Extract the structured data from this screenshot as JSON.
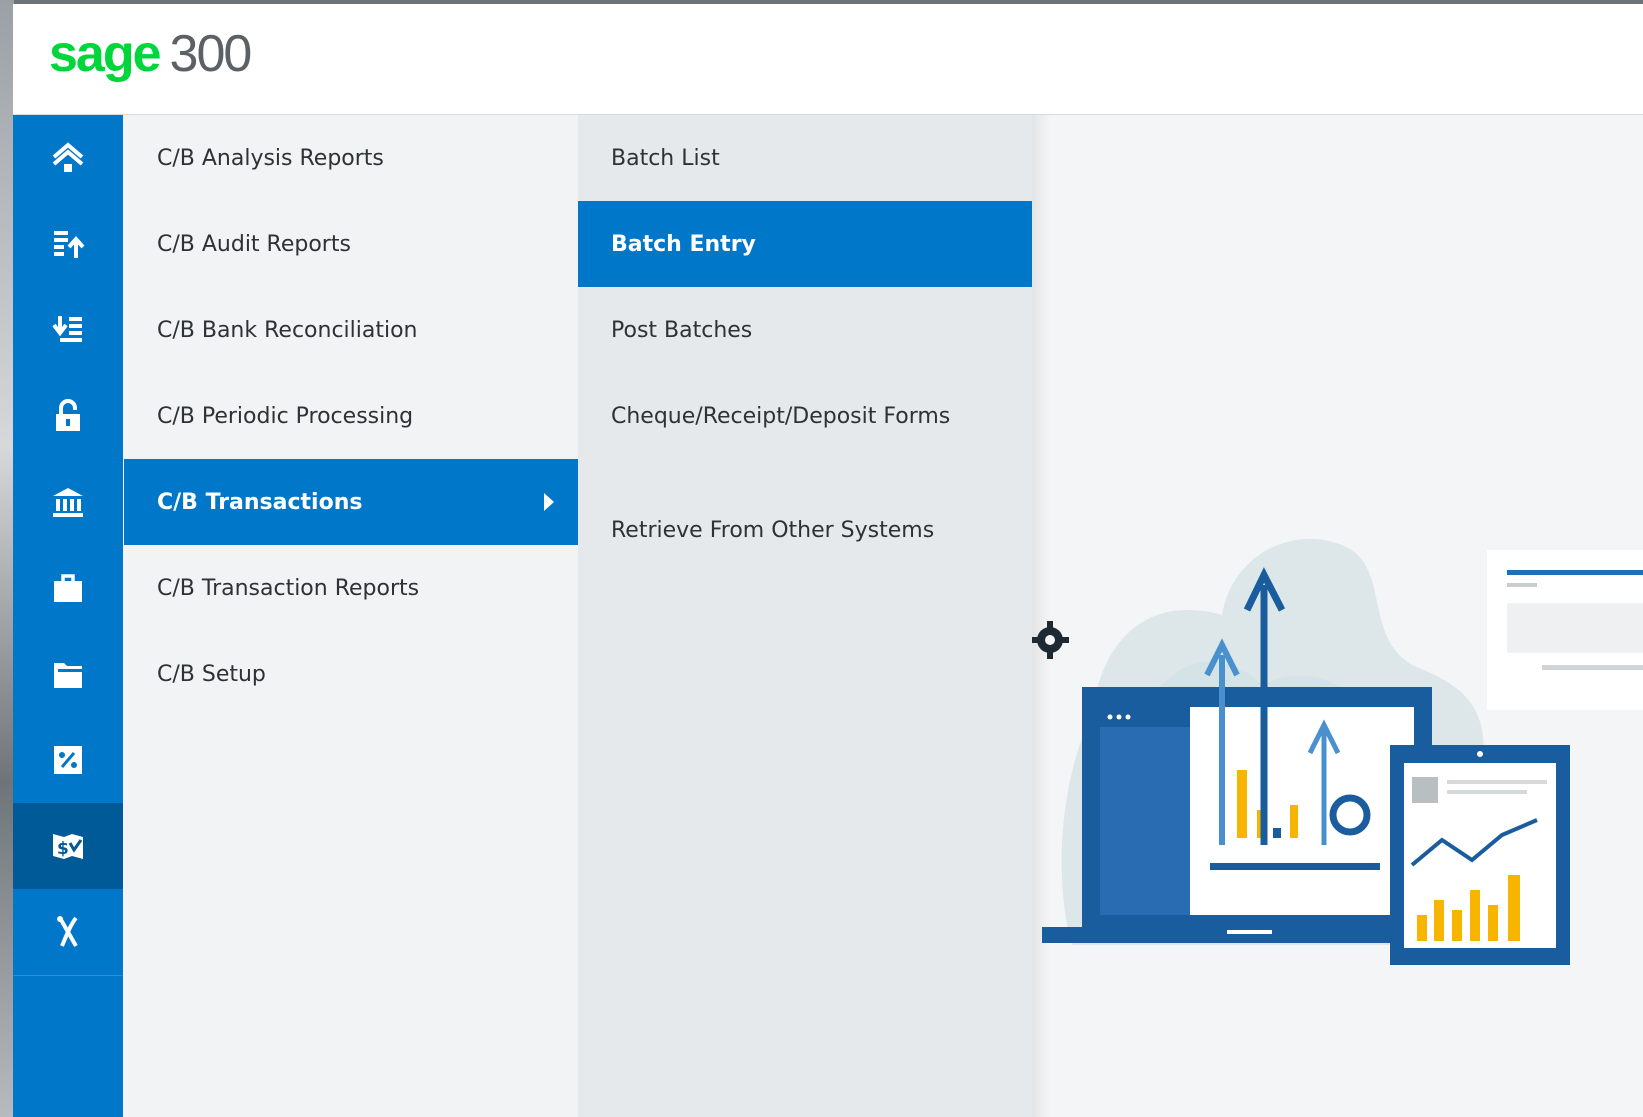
{
  "brand": {
    "name": "sage",
    "product": "300",
    "brand_color": "#00d639",
    "accent_color": "#0077c8"
  },
  "rail": {
    "items": [
      {
        "icon": "home-icon"
      },
      {
        "icon": "list-upload-icon"
      },
      {
        "icon": "list-download-icon"
      },
      {
        "icon": "lock-icon"
      },
      {
        "icon": "bank-icon"
      },
      {
        "icon": "briefcase-icon"
      },
      {
        "icon": "folder-icon"
      },
      {
        "icon": "percent-icon"
      },
      {
        "icon": "cashbook-icon",
        "active": true
      },
      {
        "icon": "tools-icon"
      }
    ]
  },
  "menu": {
    "items": [
      {
        "label": "C/B Analysis Reports"
      },
      {
        "label": "C/B Audit Reports"
      },
      {
        "label": "C/B Bank Reconciliation"
      },
      {
        "label": "C/B Periodic Processing"
      },
      {
        "label": "C/B Transactions",
        "active": true
      },
      {
        "label": "C/B Transaction Reports"
      },
      {
        "label": "C/B Setup"
      }
    ]
  },
  "submenu": {
    "items": [
      {
        "label": "Batch List"
      },
      {
        "label": "Batch Entry",
        "active": true
      },
      {
        "label": "Post Batches"
      },
      {
        "label": "Cheque/Receipt/Deposit Forms"
      },
      {
        "label": "Retrieve From Other Systems"
      }
    ]
  }
}
